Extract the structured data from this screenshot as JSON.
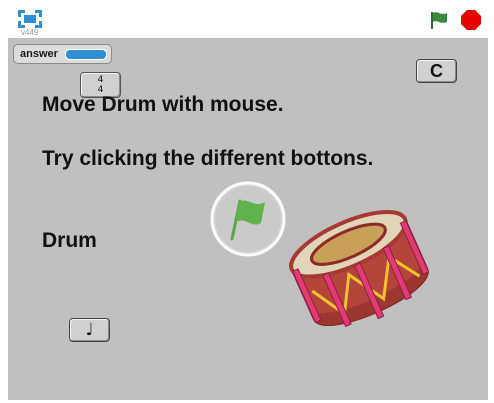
{
  "player": {
    "version": "v449",
    "icons": {
      "fullscreen": "fullscreen-icon",
      "green_flag": "green-flag-icon",
      "stop": "stop-icon"
    },
    "colors": {
      "accent": "#2e8fd4",
      "flag": "#3c8a3c",
      "stop": "#e60000",
      "stage": "#c0c0c0"
    }
  },
  "stage": {
    "variable_monitor": {
      "label": "answer",
      "value": ""
    },
    "buttons": {
      "time_signature_top": "4",
      "time_signature_bottom": "4",
      "c_label": "C",
      "note_label": "♩"
    },
    "text": {
      "line1": "Move Drum with mouse.",
      "line2": "Try clicking the different bottons.",
      "line3": "Drum"
    }
  }
}
